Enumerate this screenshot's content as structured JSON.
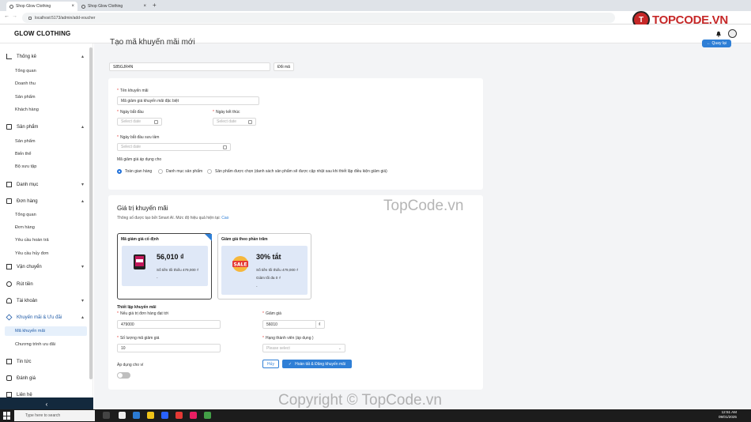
{
  "browser": {
    "tabs": [
      "Shop Glow Clothing",
      "Shop Glow Clothing"
    ],
    "url": "localhost:5173/admin/add-voucher"
  },
  "watermark": {
    "logo_text": "TOPCODE.VN",
    "center": "TopCode.vn",
    "bottom": "Copyright © TopCode.vn"
  },
  "header": {
    "brand": "GLOW CLOTHING"
  },
  "sidebar": {
    "groups": [
      {
        "label": "Thống kê",
        "items": [
          "Tổng quan",
          "Doanh thu",
          "Sản phẩm",
          "Khách hàng"
        ]
      },
      {
        "label": "Sản phẩm",
        "items": [
          "Sản phẩm",
          "Biến thể",
          "Bộ sưu tập"
        ]
      },
      {
        "label": "Danh mục",
        "items": []
      },
      {
        "label": "Đơn hàng",
        "items": [
          "Tổng quan",
          "Đơn hàng",
          "Yêu cầu hoàn trả",
          "Yêu cầu hủy đơn"
        ]
      },
      {
        "label": "Vận chuyển",
        "items": []
      },
      {
        "label": "Rút tiền",
        "items": []
      },
      {
        "label": "Tài khoản",
        "items": []
      },
      {
        "label": "Khuyến mãi & Ưu đãi",
        "items": [
          "Mã khuyến mãi",
          "Chương trình ưu đãi"
        ]
      },
      {
        "label": "Tin tức",
        "items": []
      },
      {
        "label": "Đánh giá",
        "items": []
      },
      {
        "label": "Liên hệ",
        "items": []
      }
    ],
    "collapse_icon": "‹"
  },
  "page": {
    "title": "Tạo mã khuyến mãi mới",
    "back_button": "← Quay lại",
    "code_value": "S85GJR4N",
    "change_code_button": "Đổi mã"
  },
  "form": {
    "name_label": "Tên khuyến mãi",
    "name_value": "Mã giảm giá khuyến mãi đặc biệt",
    "start_label": "Ngày bắt đầu",
    "end_label": "Ngày kết thúc",
    "date_placeholder": "Select date",
    "collect_label": "Ngày bắt đầu sưu tầm",
    "apply_label": "Mã giảm giá áp dụng cho",
    "apply_options": [
      "Toàn gian hàng",
      "Danh mục sản phẩm",
      "Sản phẩm được chọn (danh sách sản phẩm sẽ được cập nhật sau khi thiết lập điều kiện giảm giá)"
    ],
    "apply_selected": 0
  },
  "value_section": {
    "title": "Giá trị khuyến mãi",
    "subtitle": "Thông số được tạo bởi Smart AI. Mức độ hiệu quả hiện tại:",
    "efficiency": "Cao",
    "cards": [
      {
        "title": "Mã giảm giá cố định",
        "amount": "56,010 ₫",
        "min_order": "Số tiền tối thiểu 479,000 ₫",
        "extra": "-",
        "selected": true
      },
      {
        "title": "Giảm giá theo phần trăm",
        "amount": "30% tắt",
        "min_order": "Số tiền tối thiểu 479,000 ₫",
        "max_discount": "Giảm tối đa 0 ₫",
        "extra": "-",
        "selected": false
      }
    ],
    "settings_title": "Thiết lập khuyến mãi",
    "min_order_label": "Nếu giá trị đơn hàng đạt tới",
    "min_order_value": "479000",
    "discount_label": "Giảm giá",
    "discount_value": "56010",
    "currency": "₫",
    "qty_label": "Số lượng mã giảm giá",
    "qty_value": "10",
    "member_label": "Hạng thành viên (áp dụng )",
    "member_placeholder": "Please select",
    "apply_with_label": "Áp dụng cho ví",
    "cancel_button": "Hủy",
    "submit_button": "Hoàn tất & Đăng khuyến mãi"
  },
  "taskbar": {
    "search_placeholder": "Type here to search",
    "time": "12:51 AM",
    "date": "09/01/2025"
  },
  "colors": {
    "accent": "#2f7fd6",
    "sidebar_active_bg": "#e6f0fb",
    "page_bg": "#f3f4f6",
    "voucher_bg": "#dfe8f7"
  }
}
